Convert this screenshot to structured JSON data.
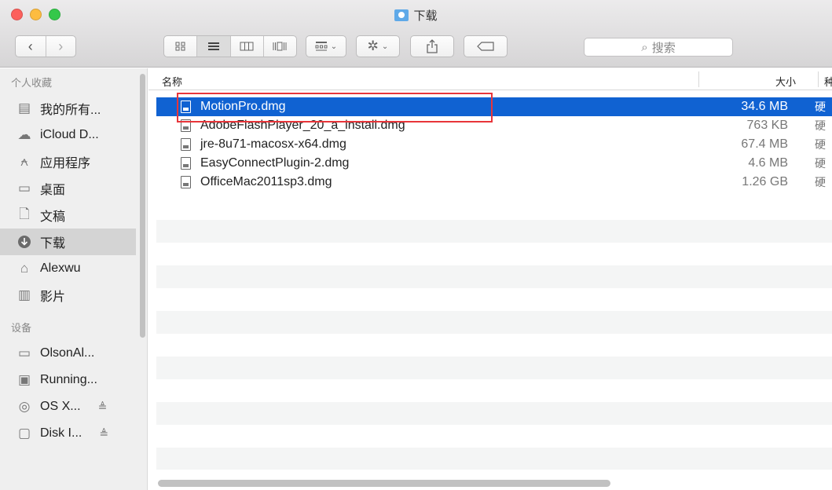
{
  "window": {
    "title": "下载",
    "title_icon": "downloads-folder-icon"
  },
  "toolbar": {
    "back_icon": "‹",
    "forward_icon": "›",
    "search_placeholder": "搜索",
    "views": [
      "icon-view",
      "list-view",
      "column-view",
      "coverflow-view"
    ],
    "active_view": "list-view"
  },
  "sidebar": {
    "favorites_heading": "个人收藏",
    "favorites": [
      {
        "label": "我的所有...",
        "icon": "all-my-files-icon"
      },
      {
        "label": "iCloud D...",
        "icon": "icloud-icon"
      },
      {
        "label": "应用程序",
        "icon": "applications-icon"
      },
      {
        "label": "桌面",
        "icon": "desktop-icon"
      },
      {
        "label": "文稿",
        "icon": "documents-icon"
      },
      {
        "label": "下载",
        "icon": "downloads-icon",
        "selected": true
      },
      {
        "label": "Alexwu",
        "icon": "home-icon"
      },
      {
        "label": "影片",
        "icon": "movies-icon"
      }
    ],
    "devices_heading": "设备",
    "devices": [
      {
        "label": "OlsonAl...",
        "icon": "computer-icon"
      },
      {
        "label": "Running...",
        "icon": "disk-image-icon"
      },
      {
        "label": "OS X...",
        "icon": "optical-disk-icon",
        "eject": "≜"
      },
      {
        "label": "Disk I...",
        "icon": "disk-icon",
        "eject": "≜"
      }
    ]
  },
  "list": {
    "columns": {
      "name": "名称",
      "size": "大小",
      "kind": "种"
    },
    "files": [
      {
        "name": "MotionPro.dmg",
        "size": "34.6 MB",
        "kind": "硬",
        "selected": true
      },
      {
        "name": "AdobeFlashPlayer_20_a_install.dmg",
        "size": "763 KB",
        "kind": "硬"
      },
      {
        "name": "jre-8u71-macosx-x64.dmg",
        "size": "67.4 MB",
        "kind": "硬"
      },
      {
        "name": "EasyConnectPlugin-2.dmg",
        "size": "4.6 MB",
        "kind": "硬"
      },
      {
        "name": "OfficeMac2011sp3.dmg",
        "size": "1.26 GB",
        "kind": "硬"
      }
    ]
  },
  "colors": {
    "selection": "#1062d2",
    "highlight_box": "#e8353a"
  }
}
